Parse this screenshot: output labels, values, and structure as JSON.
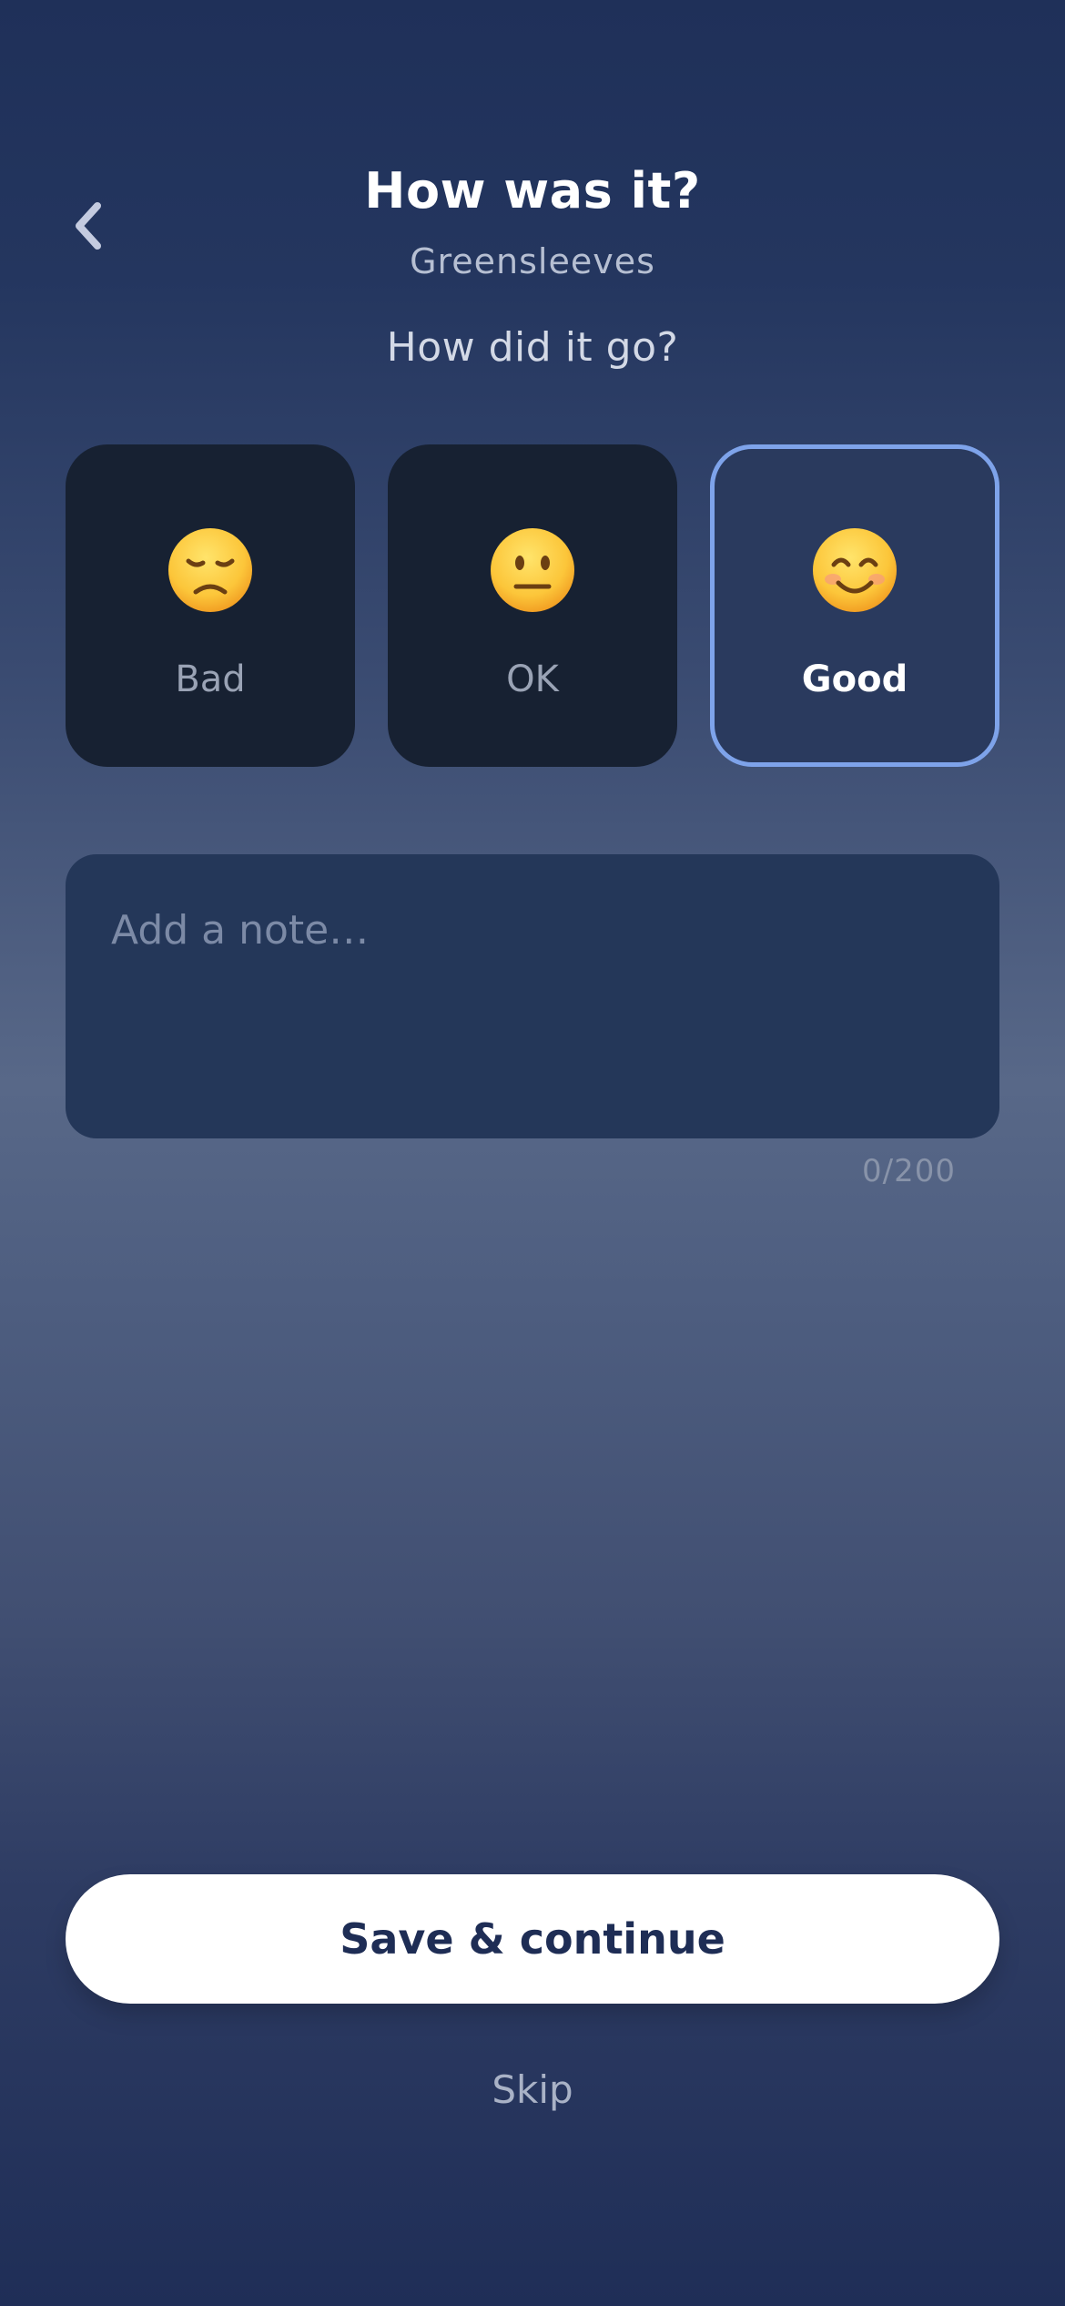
{
  "header": {
    "title": "How was it?",
    "subtitle": "Greensleeves",
    "back_icon": "chevron-left-icon"
  },
  "question": "How did it go?",
  "ratings": [
    {
      "label": "Bad",
      "icon": "disappointed-face-icon",
      "selected": false
    },
    {
      "label": "OK",
      "icon": "neutral-face-icon",
      "selected": false
    },
    {
      "label": "Good",
      "icon": "smiling-face-icon",
      "selected": true
    }
  ],
  "note": {
    "placeholder": "Add a note…",
    "value": "",
    "counter": "0/200"
  },
  "actions": {
    "save_label": "Save & continue",
    "skip_label": "Skip"
  },
  "colors": {
    "accent_border": "#7ea3ea",
    "card_bg": "#172132",
    "card_selected_bg": "#2a3a5e",
    "note_bg": "#243759",
    "button_text": "#1e2d55"
  }
}
